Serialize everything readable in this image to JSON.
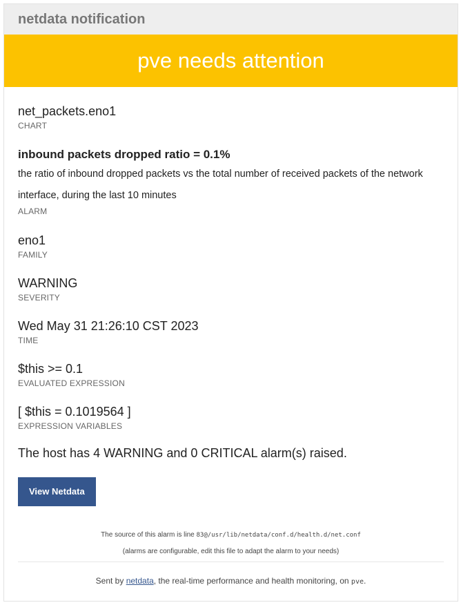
{
  "header": {
    "title": "netdata notification"
  },
  "banner": {
    "text": "pve needs attention"
  },
  "chart": {
    "value": "net_packets.eno1",
    "label": "CHART"
  },
  "alarm": {
    "title": "inbound packets dropped ratio = 0.1%",
    "description": "the ratio of inbound dropped packets vs the total number of received packets of the network interface, during the last 10 minutes",
    "label": "ALARM"
  },
  "family": {
    "value": "eno1",
    "label": "FAMILY"
  },
  "severity": {
    "value": "WARNING",
    "label": "SEVERITY"
  },
  "time": {
    "value": "Wed May 31 21:26:10 CST 2023",
    "label": "TIME"
  },
  "expression": {
    "value": "$this >= 0.1",
    "label": "EVALUATED EXPRESSION"
  },
  "variables": {
    "value": "[ $this = 0.1019564 ]",
    "label": "EXPRESSION VARIABLES"
  },
  "summary": "The host has 4 WARNING and 0 CRITICAL alarm(s) raised.",
  "button": {
    "label": "View Netdata"
  },
  "footer": {
    "source_prefix": "The source of this alarm is line",
    "source_path": "83@/usr/lib/netdata/conf.d/health.d/net.conf",
    "source_note": "(alarms are configurable, edit this file to adapt the alarm to your needs)",
    "sent_prefix": "Sent by",
    "sent_link": "netdata",
    "sent_middle": ", the real-time performance and health monitoring, on",
    "sent_host": "pve",
    "sent_suffix": "."
  }
}
